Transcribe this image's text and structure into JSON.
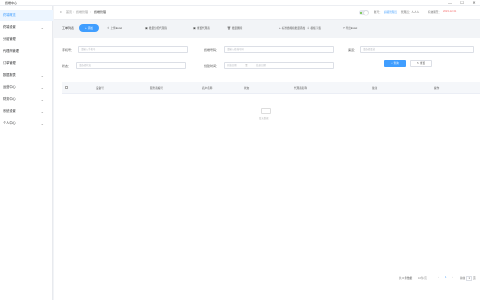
{
  "window": {
    "title": "终端中心",
    "controls": [
      "—",
      "☐",
      "✕"
    ]
  },
  "sidebar": {
    "items": [
      {
        "label": "终端概览",
        "active": true,
        "chevron": false
      },
      {
        "label": "终端设置",
        "active": false,
        "chevron": true
      },
      {
        "label": "分组管理",
        "active": false,
        "chevron": false
      },
      {
        "label": "代理商管理",
        "active": false,
        "chevron": false
      },
      {
        "label": "订单管理",
        "active": false,
        "chevron": false
      },
      {
        "label": "数据报表",
        "active": false,
        "chevron": true
      },
      {
        "label": "运营中心",
        "active": false,
        "chevron": true
      },
      {
        "label": "财务中心",
        "active": false,
        "chevron": true
      },
      {
        "label": "系统设置",
        "active": false,
        "chevron": true
      },
      {
        "label": "个人中心",
        "active": false,
        "chevron": true
      }
    ]
  },
  "topbar": {
    "breadcrumb_home": "首页",
    "breadcrumb_sep": "/",
    "breadcrumb_parent": "终端管理",
    "breadcrumb_current": "终端管理",
    "user_label": "账号：",
    "user_name": "超级管理员",
    "user_role": "管理员：人人人",
    "status_label": "有效期至：",
    "expiry": "2023-12-31"
  },
  "toolbar": {
    "label": "工单列表",
    "buttons": [
      {
        "icon": "+",
        "label": "添加"
      },
      {
        "icon": "⇧",
        "label": "上传Excel"
      },
      {
        "icon": "▣",
        "label": "批量分配代理商"
      },
      {
        "icon": "▣",
        "label": "重置代理商"
      },
      {
        "icon": "🗑",
        "label": "批量删除"
      },
      {
        "icon": "+",
        "label": "标准终端和批量添加"
      },
      {
        "icon": "⇩",
        "label": "模板下载"
      },
      {
        "icon": "?",
        "label": "导出Excel"
      }
    ]
  },
  "filters": {
    "phone_label": "手机号：",
    "phone_placeholder": "请输入手机号",
    "device_label": "终端号码：",
    "device_placeholder": "请输入终端号码",
    "agent_label": "渠道：",
    "agent_placeholder": "请选择渠道",
    "status_label": "状态：",
    "status_placeholder": "请选择状态",
    "time_label": "创建时间：",
    "time_start": "开始日期",
    "time_sep": "至",
    "time_end": "结束日期",
    "query_label": "查询",
    "reset_label": "重置"
  },
  "table": {
    "columns": [
      "",
      "设备号",
      "服务商编号",
      "商户名称",
      "状态",
      "代理商名称",
      "备注",
      "操作"
    ],
    "empty_text": "暂无数据"
  },
  "pager": {
    "total_text": "共 0 条数据",
    "page_size": "10条/页",
    "prev": "‹",
    "page": "1",
    "next": "›",
    "goto_label": "前往",
    "goto_value": "1",
    "page_suffix": "页"
  },
  "colors": {
    "primary": "#409eff",
    "active_bg": "#ecf5ff",
    "page_bg": "#f2f4f7",
    "toggle_dot": "#67c23a"
  },
  "icons": {
    "chevron": "chevron-down-icon",
    "toggle": "theme-toggle-icon"
  }
}
